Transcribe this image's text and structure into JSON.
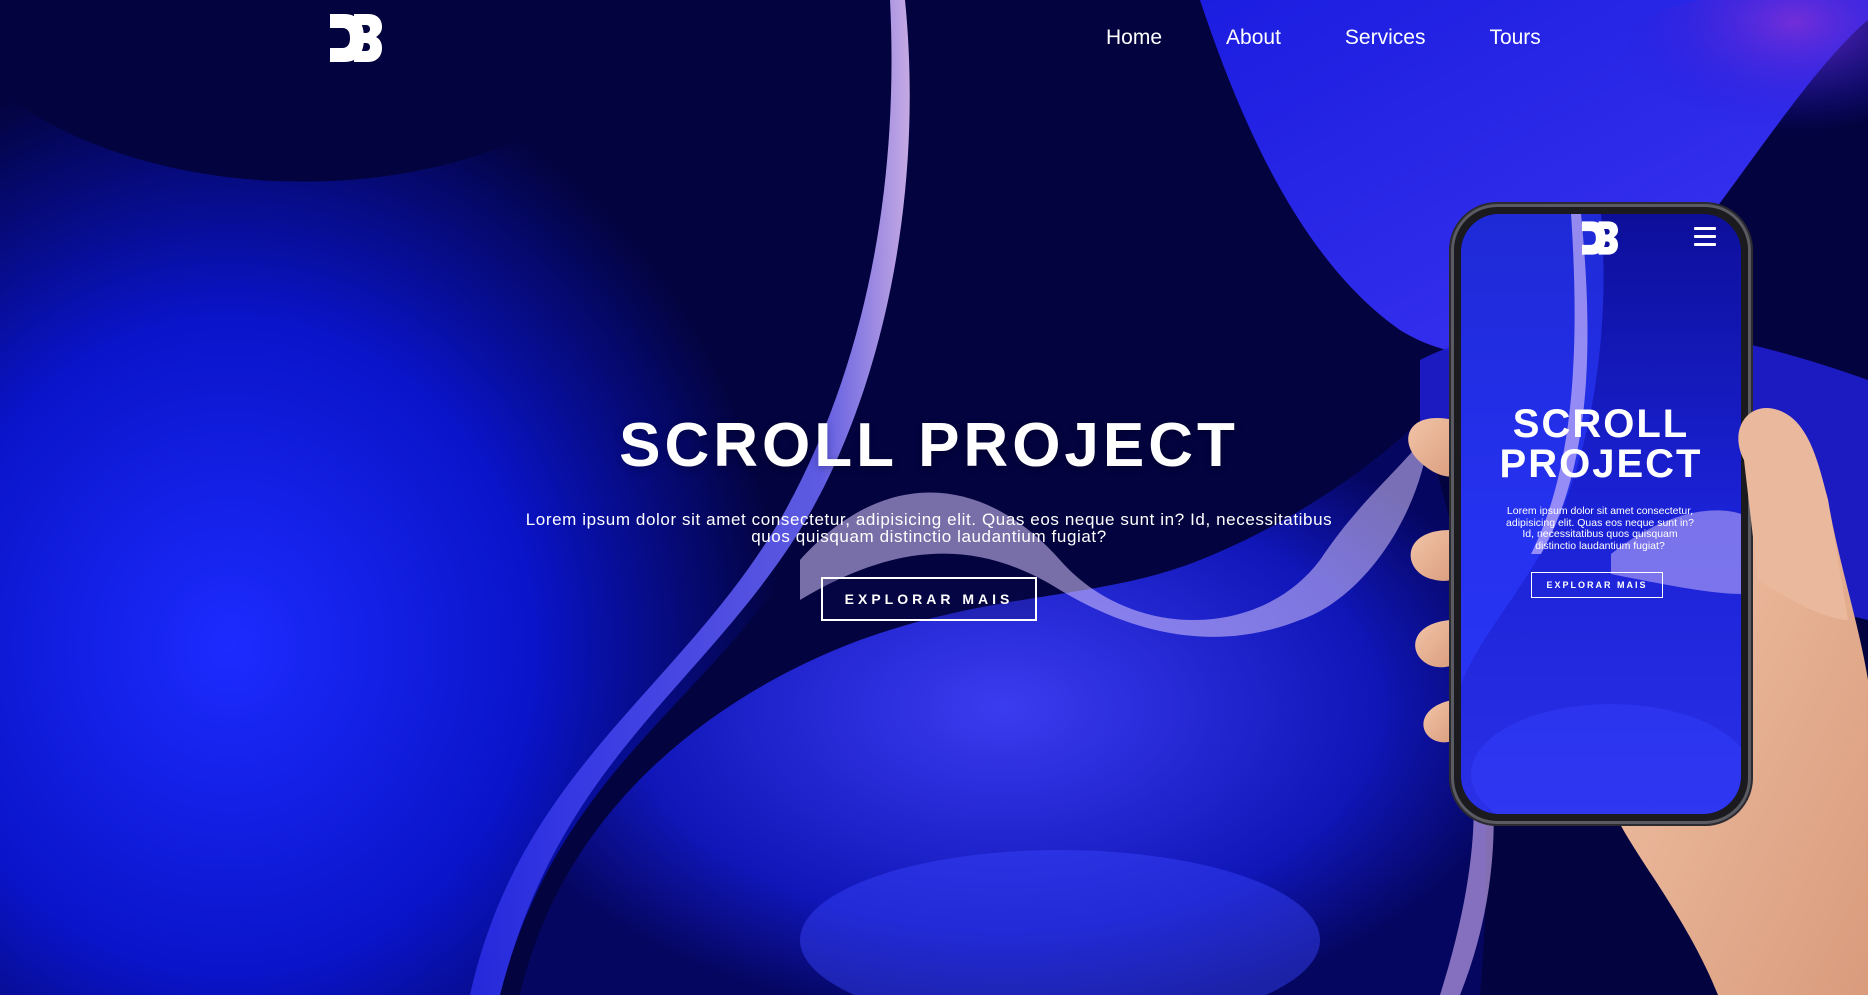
{
  "brand": {
    "logo_icon": "d3-logo-icon"
  },
  "nav": {
    "items": [
      {
        "label": "Home"
      },
      {
        "label": "About"
      },
      {
        "label": "Services"
      },
      {
        "label": "Tours"
      }
    ]
  },
  "hero": {
    "title": "SCROLL PROJECT",
    "text": "Lorem ipsum dolor sit amet consectetur, adipisicing elit. Quas eos neque sunt in? Id, necessitatibus quos quisquam distinctio laudantium fugiat?",
    "button_label": "EXPLORAR MAIS"
  },
  "mobile_preview": {
    "logo_icon": "d3-logo-icon",
    "menu_icon": "hamburger-menu-icon",
    "title": "SCROLL PROJECT",
    "text": "Lorem ipsum dolor sit amet consectetur, adipisicing elit. Quas eos neque sunt in? Id, necessitatibus quos quisquam distinctio laudantium fugiat?",
    "button_label": "EXPLORAR MAIS"
  },
  "colors": {
    "background_dark": "#03033f",
    "accent_blue": "#1a2cff",
    "accent_violet": "#b07cff",
    "text": "#ffffff"
  }
}
